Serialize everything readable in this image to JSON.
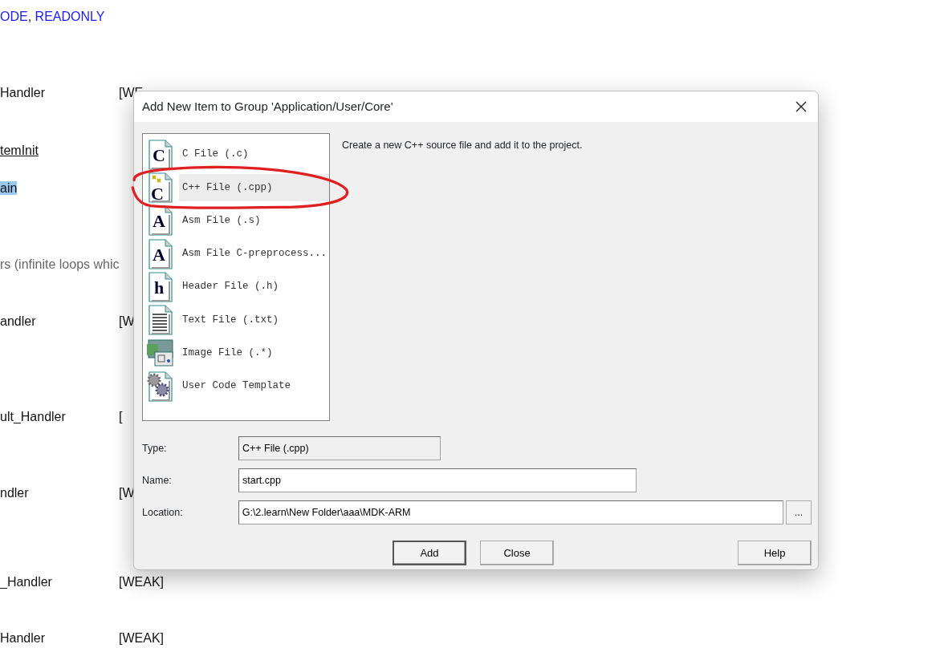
{
  "document_lines": [
    {
      "kind": "links",
      "parts": [
        "ODE",
        "READONLY"
      ],
      "separator": ","
    },
    {
      "kind": "plain",
      "text": "Handler",
      "column_2": "[WE"
    },
    {
      "kind": "link",
      "text": "temInit"
    },
    {
      "kind": "highlighted",
      "text": "ain"
    },
    {
      "kind": "comment",
      "text": "rs (infinite loops whic"
    },
    {
      "kind": "plain",
      "text": "andler",
      "column_2": "[W"
    },
    {
      "kind": "plain",
      "text": "ult_Handler",
      "column_2": "["
    },
    {
      "kind": "plain",
      "text": "ndler",
      "column_2": "[W"
    },
    {
      "kind": "plain",
      "text": "_Handler",
      "column_2": "[WEAK]"
    },
    {
      "kind": "plain",
      "text": "Handler",
      "column_2": "[WEAK]"
    }
  ],
  "dialog": {
    "title": "Add New Item to Group 'Application/User/Core'",
    "items": [
      {
        "label": "C File (.c)",
        "kind": "letter",
        "glyph": "C",
        "selected": false
      },
      {
        "label": "C++ File (.cpp)",
        "kind": "cpp",
        "glyph": "C",
        "selected": true
      },
      {
        "label": "Asm File (.s)",
        "kind": "letter",
        "glyph": "A",
        "selected": false
      },
      {
        "label": "Asm File C-preprocess...",
        "kind": "letter",
        "glyph": "A",
        "selected": false
      },
      {
        "label": "Header File (.h)",
        "kind": "letter",
        "glyph": "h",
        "selected": false
      },
      {
        "label": "Text File (.txt)",
        "kind": "text",
        "selected": false
      },
      {
        "label": "Image File (.*)",
        "kind": "image",
        "selected": false
      },
      {
        "label": "User Code Template",
        "kind": "gears",
        "selected": false
      }
    ],
    "description": "Create a new C++ source file and add it to the project.",
    "fields": [
      {
        "label": "Type:",
        "value": "C++ File (.cpp)",
        "kind": "readonly"
      },
      {
        "label": "Name:",
        "value": "start.cpp",
        "kind": "short"
      },
      {
        "label": "Location:",
        "value": "G:\\2.learn\\New Folder\\aaa\\MDK-ARM",
        "kind": "browse",
        "button": "..."
      }
    ],
    "buttons": [
      {
        "label": "Add",
        "default": true
      },
      {
        "label": "Close",
        "default": false
      },
      {
        "label": "Help",
        "default": false
      }
    ]
  }
}
